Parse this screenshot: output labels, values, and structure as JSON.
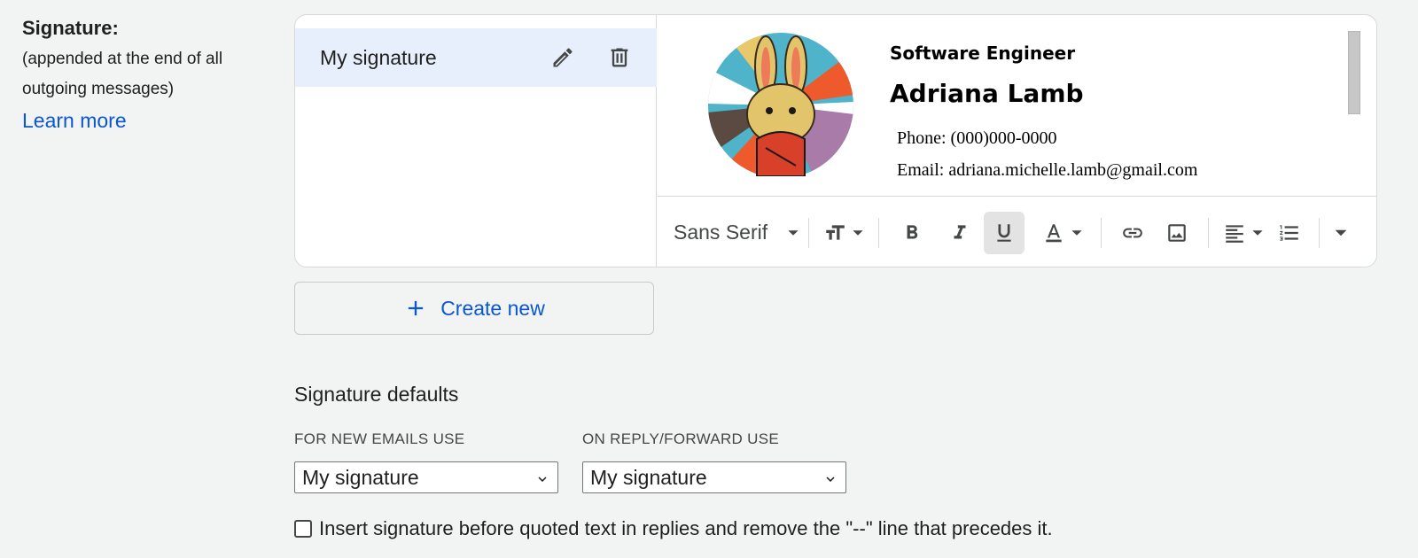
{
  "signature_section": {
    "title": "Signature:",
    "description_line1": "(appended at the end of all",
    "description_line2": "outgoing messages)",
    "learn_more": "Learn more"
  },
  "signature_list": {
    "items": [
      {
        "label": "My signature",
        "selected": true
      }
    ]
  },
  "signature_preview": {
    "role": "Software Engineer",
    "name": "Adriana Lamb",
    "phone": "Phone: (000)000-0000",
    "email": "Email: adriana.michelle.lamb@gmail.com",
    "image_icon": "rabbit-avatar-image"
  },
  "toolbar": {
    "font": "Sans Serif",
    "buttons": [
      "text-size-icon",
      "bold-icon",
      "italic-icon",
      "underline-icon",
      "text-color-icon",
      "link-icon",
      "insert-image-icon",
      "align-icon",
      "numbered-list-icon",
      "more-formatting-icon"
    ],
    "active": "underline-icon"
  },
  "create_new": {
    "label": "Create new"
  },
  "defaults": {
    "title": "Signature defaults",
    "new_emails_label": "FOR NEW EMAILS USE",
    "new_emails_value": "My signature",
    "reply_forward_label": "ON REPLY/FORWARD USE",
    "reply_forward_value": "My signature"
  },
  "insert_option": {
    "label": "Insert signature before quoted text in replies and remove the \"--\" line that precedes it.",
    "checked": false
  },
  "colors": {
    "accent": "#0b57d0",
    "selected_row": "#e8effc",
    "background": "#f2f3f3"
  }
}
